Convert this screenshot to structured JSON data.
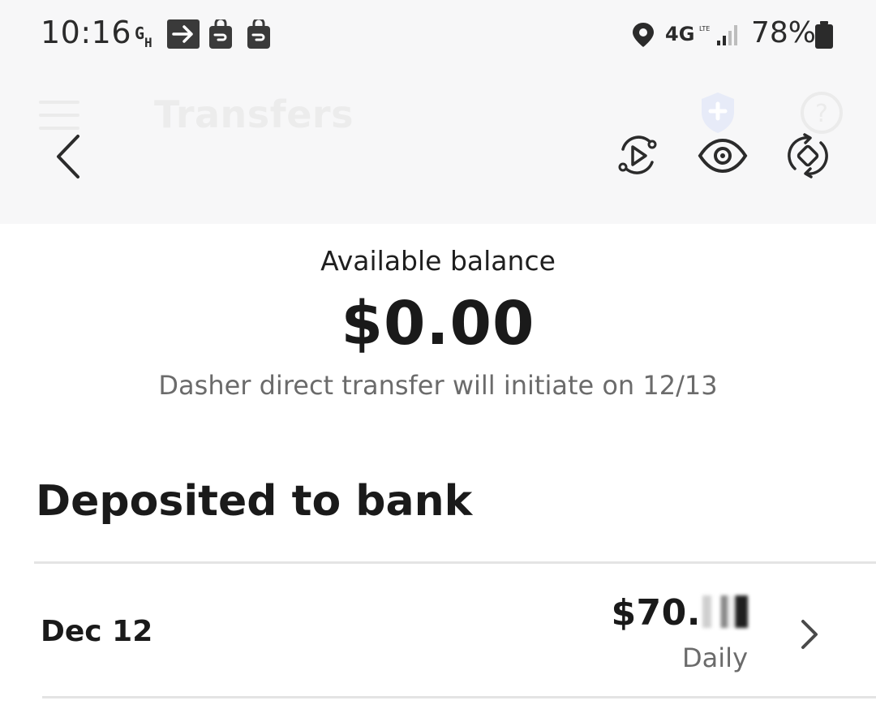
{
  "status_bar": {
    "time": "10:16",
    "network": "4G",
    "battery": "78%"
  },
  "header": {
    "title": "Transfers",
    "icons": [
      "menu-icon",
      "back-icon",
      "shield-plus-icon",
      "help-icon",
      "screen-record-icon",
      "eye-icon",
      "rotate-icon"
    ]
  },
  "balance": {
    "label": "Available balance",
    "amount": "$0.00",
    "note": "Dasher direct transfer will initiate on 12/13"
  },
  "deposits": {
    "title": "Deposited to bank",
    "items": [
      {
        "date": "Dec 12",
        "amount": "$70.",
        "frequency": "Daily"
      }
    ]
  },
  "colors": {
    "header_bg": "#f7f7f8",
    "text": "#1a1a1a",
    "muted_text": "#6b6b6b",
    "divider": "#e4e4e4"
  }
}
